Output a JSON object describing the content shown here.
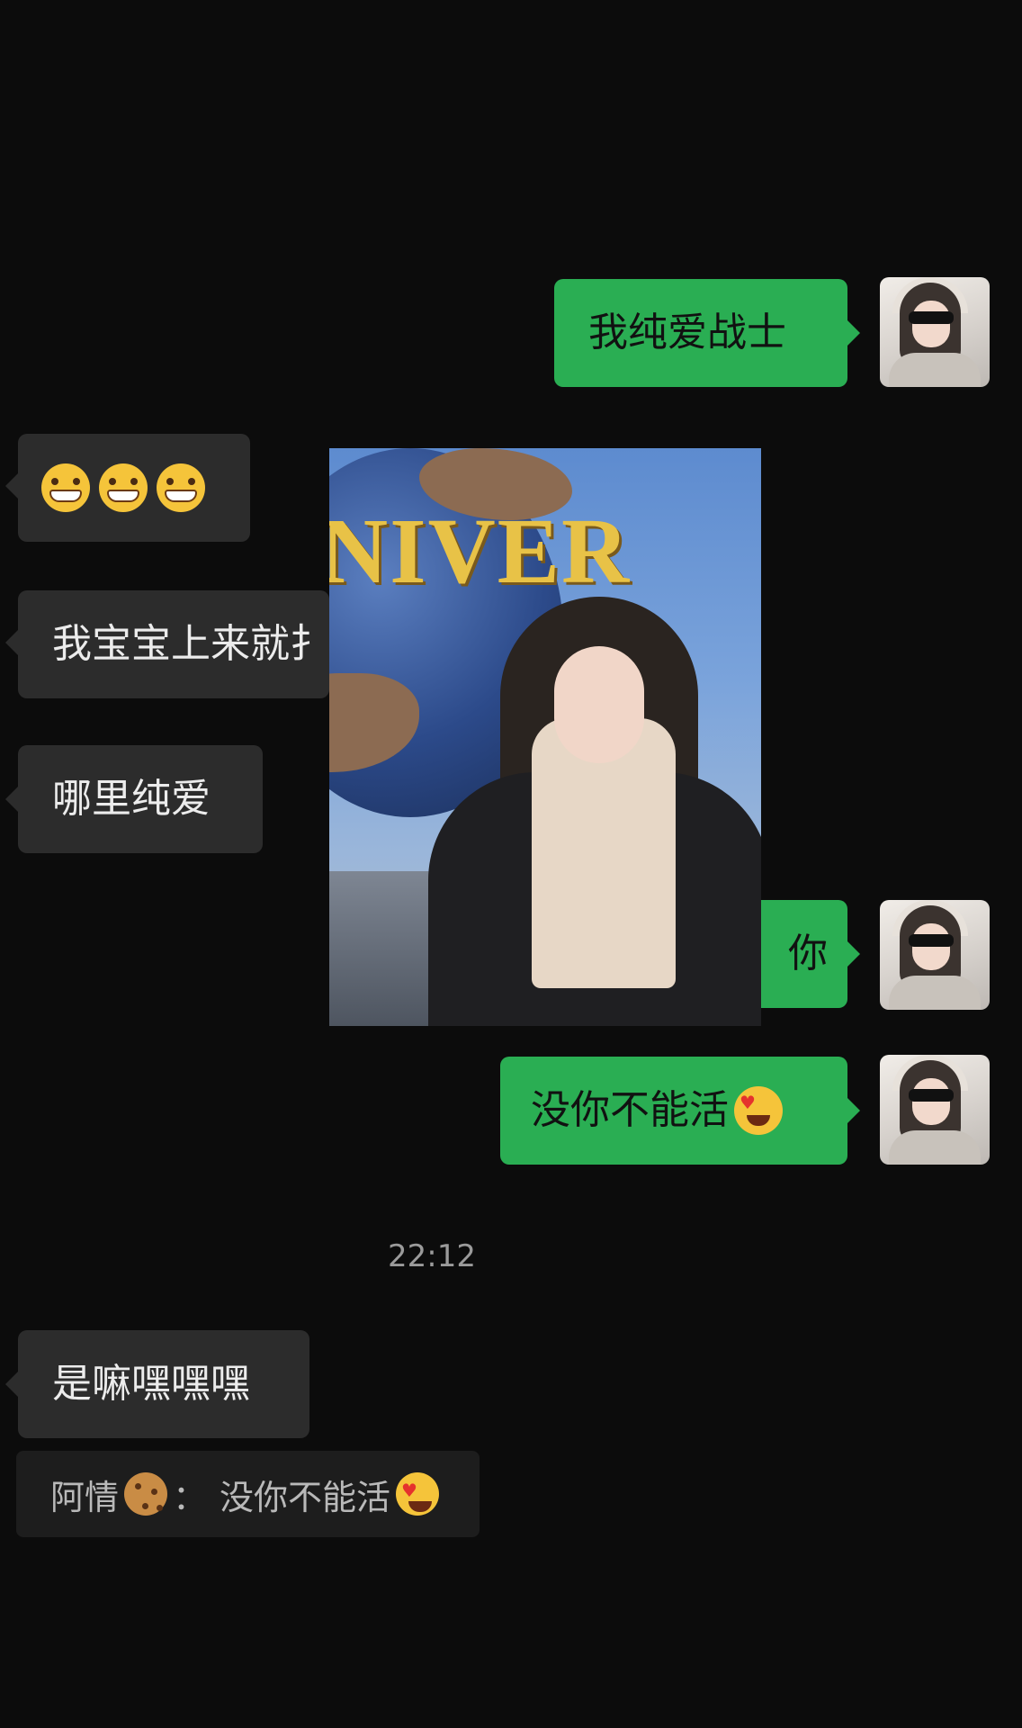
{
  "messages": [
    {
      "side": "out",
      "text": "我纯爱战士"
    },
    {
      "side": "in",
      "emoji": [
        "grin-emoji",
        "grin-emoji",
        "grin-emoji"
      ]
    },
    {
      "side": "in",
      "text": "我宝宝上来就扌"
    },
    {
      "side": "in",
      "text": "哪里纯爱"
    },
    {
      "side": "out",
      "text": "你"
    },
    {
      "side": "out",
      "text": "没你不能活",
      "emoji": "heart-eyes-emoji"
    },
    {
      "side": "in",
      "text": "是嘛嘿嘿嘿"
    }
  ],
  "timestamp": "22:12",
  "photo": {
    "sign_text": "NIVER"
  },
  "quote": {
    "sender": "阿情",
    "sender_emoji": "cookie-emoji",
    "separator": "：",
    "text": "没你不能活",
    "text_emoji": "heart-eyes-emoji"
  },
  "colors": {
    "background": "#0c0c0c",
    "incoming_bubble": "#2c2c2c",
    "outgoing_bubble": "#2aae53"
  }
}
